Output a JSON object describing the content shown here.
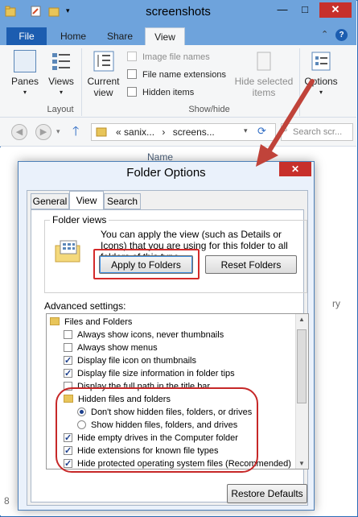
{
  "window": {
    "title": "screenshots",
    "controls": {
      "minimize": "—",
      "maximize": "□",
      "close": "✕"
    }
  },
  "ribbon": {
    "tabs": [
      "File",
      "Home",
      "Share",
      "View"
    ],
    "active_tab": "View",
    "panes_label": "Panes",
    "views_label": "Views",
    "layout_group": "Layout",
    "current_view_label": "Current\nview",
    "checkboxes": [
      {
        "label": "Image file names",
        "checked": false,
        "enabled": false
      },
      {
        "label": "File name extensions",
        "checked": false,
        "enabled": true
      },
      {
        "label": "Hidden items",
        "checked": false,
        "enabled": true
      }
    ],
    "hide_selected_label": "Hide selected\nitems",
    "show_hide_group": "Show/hide",
    "options_label": "Options"
  },
  "address_bar": {
    "path": [
      "«",
      "sanix...",
      "›",
      "screens..."
    ],
    "search_placeholder": "Search scr..."
  },
  "content": {
    "column_name": "Name",
    "ghost_texts": [
      "ry",
      "8"
    ]
  },
  "dialog": {
    "title": "Folder Options",
    "tabs": [
      "General",
      "View",
      "Search"
    ],
    "active_tab": "View",
    "folder_views": {
      "legend": "Folder views",
      "description": "You can apply the view (such as Details or Icons) that you are using for this folder to all folders of this type.",
      "apply_button": "Apply to Folders",
      "reset_button": "Reset Folders"
    },
    "advanced_label": "Advanced settings:",
    "settings": [
      {
        "type": "folder",
        "label": "Files and Folders",
        "indent": 0
      },
      {
        "type": "checkbox",
        "label": "Always show icons, never thumbnails",
        "checked": false,
        "indent": 1
      },
      {
        "type": "checkbox",
        "label": "Always show menus",
        "checked": false,
        "indent": 1
      },
      {
        "type": "checkbox",
        "label": "Display file icon on thumbnails",
        "checked": true,
        "indent": 1
      },
      {
        "type": "checkbox",
        "label": "Display file size information in folder tips",
        "checked": true,
        "indent": 1
      },
      {
        "type": "checkbox",
        "label": "Display the full path in the title bar",
        "checked": false,
        "indent": 1
      },
      {
        "type": "folder",
        "label": "Hidden files and folders",
        "indent": 1
      },
      {
        "type": "radio",
        "label": "Don't show hidden files, folders, or drives",
        "checked": true,
        "indent": 2
      },
      {
        "type": "radio",
        "label": "Show hidden files, folders, and drives",
        "checked": false,
        "indent": 2
      },
      {
        "type": "checkbox",
        "label": "Hide empty drives in the Computer folder",
        "checked": true,
        "indent": 1
      },
      {
        "type": "checkbox",
        "label": "Hide extensions for known file types",
        "checked": true,
        "indent": 1
      },
      {
        "type": "checkbox",
        "label": "Hide protected operating system files (Recommended)",
        "checked": true,
        "indent": 1
      }
    ],
    "restore_button": "Restore Defaults"
  },
  "colors": {
    "title_bar": "#6ea3dc",
    "file_tab": "#1c5db0",
    "close_button": "#c7302b",
    "annotation_red": "#c62828"
  }
}
